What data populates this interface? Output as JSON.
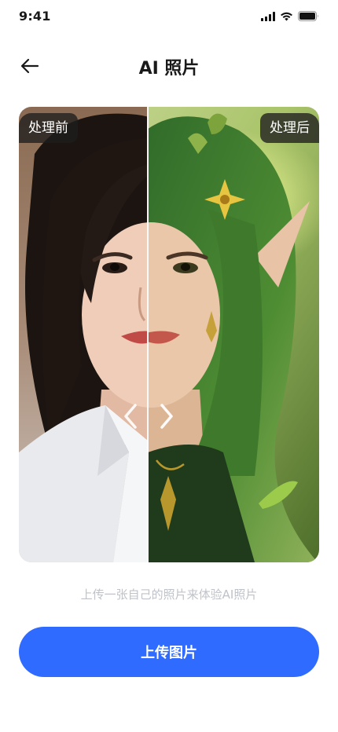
{
  "status_bar": {
    "time": "9:41"
  },
  "header": {
    "title": "AI 照片"
  },
  "compare": {
    "before_label": "处理前",
    "after_label": "处理后"
  },
  "hint": "上传一张自己的照片来体验AI照片",
  "upload_button": {
    "label": "上传图片"
  },
  "colors": {
    "primary": "#2f6bff",
    "hint_text": "#bfc3c9",
    "badge_bg": "#1e1e1e"
  },
  "icons": [
    "back-arrow-icon",
    "signal-icon",
    "wifi-icon",
    "battery-icon",
    "chevron-left-icon",
    "chevron-right-icon"
  ]
}
